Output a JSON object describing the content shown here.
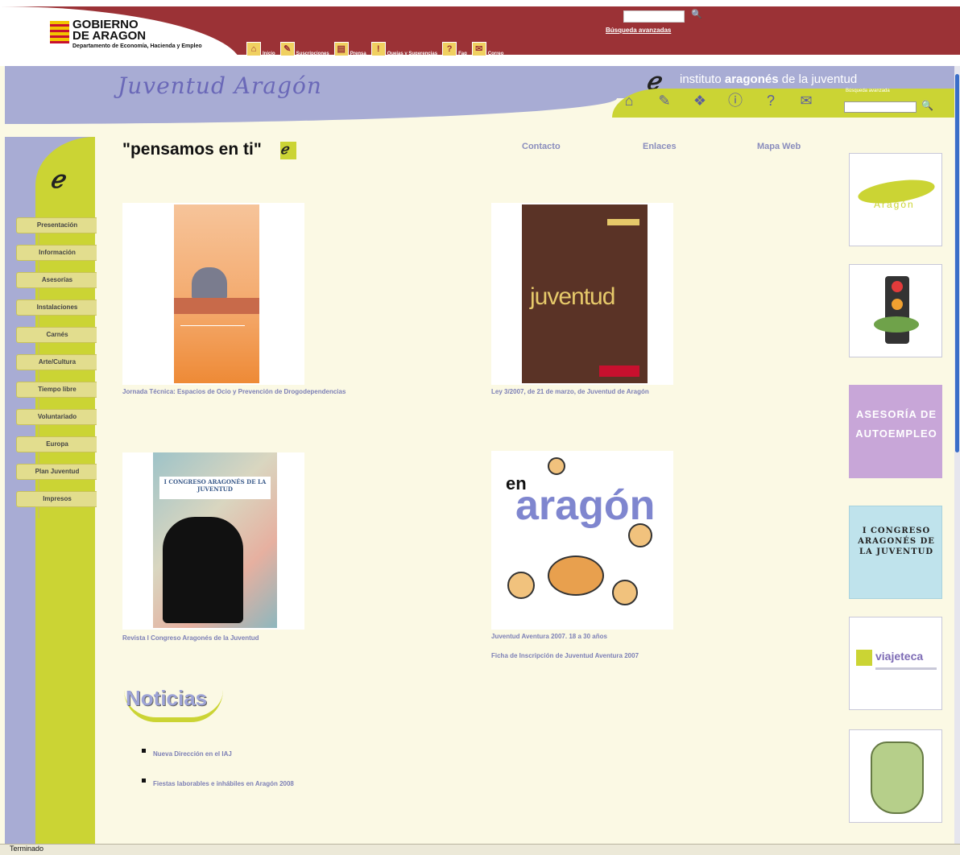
{
  "government": {
    "name_line1": "GOBIERNO",
    "name_line2": "DE ARAGON",
    "department": "Departamento de Economía, Hacienda y Empleo",
    "flag_colors": [
      "#f2c400",
      "#c8102e"
    ]
  },
  "top_nav": [
    {
      "label": "Inicio",
      "icon": "home-icon"
    },
    {
      "label": "Suscripciones",
      "icon": "subscribe-icon"
    },
    {
      "label": "Prensa",
      "icon": "press-icon"
    },
    {
      "label": "Quejas y Sugerencias",
      "icon": "exclamation-icon"
    },
    {
      "label": "Faq",
      "icon": "question-icon"
    },
    {
      "label": "Correo",
      "icon": "mail-icon"
    }
  ],
  "top_search": {
    "value": "",
    "advanced_label": "Búsqueda avanzadas"
  },
  "header": {
    "site_title": "Juventud Aragón",
    "iaj_prefix": "instituto",
    "iaj_bold": "aragonés",
    "iaj_suffix": "de la juventud",
    "search_label": "Búsqueda avanzada",
    "icons": [
      "home-icon",
      "pencil-icon",
      "book-icon",
      "alert-icon",
      "question-icon",
      "envelope-icon"
    ]
  },
  "slogan": "\"pensamos en ti\"",
  "links": {
    "contacto": "Contacto",
    "enlaces": "Enlaces",
    "mapa_web": "Mapa Web"
  },
  "left_nav": [
    "Presentación",
    "Información",
    "Asesorías",
    "Instalaciones",
    "Carnés",
    "Arte/Cultura",
    "Tiempo libre",
    "Voluntariado",
    "Europa",
    "Plan Juventud",
    "Impresos"
  ],
  "featured": [
    {
      "caption": "Jornada Técnica: Espacios de Ocio y Prevención de Drogodependencias"
    },
    {
      "caption": "Ley 3/2007, de 21 de marzo, de Juventud de Aragón",
      "cover_word": "juventud"
    },
    {
      "caption": "Revista I Congreso Aragonés de la Juventud",
      "cover_band": "I CONGRESO ARAGONÉS DE LA JUVENTUD"
    },
    {
      "caption": "Juventud Aventura 2007. 18 a 30 años",
      "caption2": "Ficha de Inscripción de Juventud Aventura 2007",
      "cover_en": "en",
      "cover_word": "aragón"
    }
  ],
  "news": {
    "title": "Noticias",
    "items": [
      "Nueva Dirección en el IAJ",
      "Fiestas laborables e inhábiles en Aragón 2008"
    ]
  },
  "right_banners": {
    "b1_text": "Aragón",
    "b3_text": "ASESORÍA DE AUTOEMPLEO",
    "b4_text": "I CONGRESO ARAGONÉS DE LA JUVENTUD",
    "b5_text": "viajeteca"
  },
  "status": "Terminado",
  "colors": {
    "banner_red": "#9b3236",
    "lavender": "#a8acd4",
    "lime": "#cbd434",
    "cream": "#fbf9e4",
    "link_blue": "#7d80b6"
  }
}
